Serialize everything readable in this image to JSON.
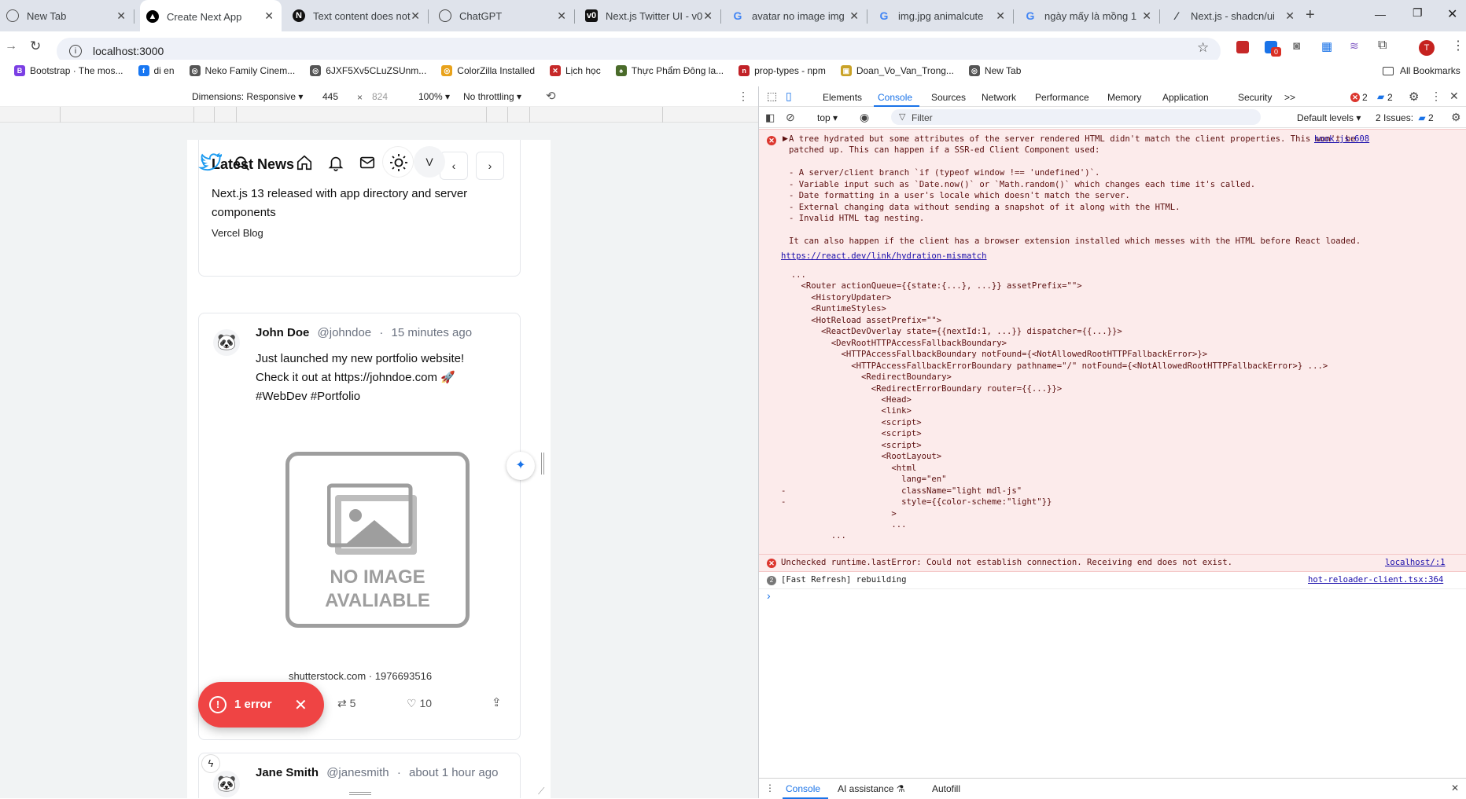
{
  "browser": {
    "tabs": [
      {
        "title": "New Tab"
      },
      {
        "title": "Create Next App"
      },
      {
        "title": "Text content does not"
      },
      {
        "title": "ChatGPT"
      },
      {
        "title": "Next.js Twitter UI - v0"
      },
      {
        "title": "avatar no image img"
      },
      {
        "title": "img.jpg animalcute"
      },
      {
        "title": "ngày mấy là mồng 1"
      },
      {
        "title": "Next.js - shadcn/ui"
      }
    ],
    "new_tab_glyph": "+",
    "url": "localhost:3000",
    "profile_initial": "T",
    "extension_badge": "0",
    "bookmarks": [
      {
        "label": "Bootstrap · The mos...",
        "icon": "B",
        "color": "#7b3fe4"
      },
      {
        "label": "di en",
        "icon": "f",
        "color": "#1877f2"
      },
      {
        "label": "Neko Family Cinem...",
        "icon": "◎",
        "color": "#555"
      },
      {
        "label": "6JXF5Xv5CLuZSUnm...",
        "icon": "◎",
        "color": "#555"
      },
      {
        "label": "ColorZilla Installed",
        "icon": "◎",
        "color": "#e8a21b"
      },
      {
        "label": "Lịch học",
        "icon": "✕",
        "color": "#c62828"
      },
      {
        "label": "Thực Phẩm Đông la...",
        "icon": "♠",
        "color": "#4a6b2a"
      },
      {
        "label": "prop-types - npm",
        "icon": "n",
        "color": "#c12127"
      },
      {
        "label": "Doan_Vo_Van_Trong...",
        "icon": "▣",
        "color": "#c9a227"
      },
      {
        "label": "New Tab",
        "icon": "◎",
        "color": "#555"
      }
    ],
    "all_bookmarks": "All Bookmarks"
  },
  "device_toolbar": {
    "dimensions": "Dimensions: Responsive",
    "width": "445",
    "times": "×",
    "height": "824",
    "zoom": "100%",
    "throttling": "No throttling"
  },
  "page": {
    "latest_news_title": "Latest News",
    "news_item_title": "Next.js 13 released with app directory and server components",
    "news_item_source": "Vercel Blog",
    "avatar_initial": "V",
    "tweets": [
      {
        "name": "John Doe",
        "handle": "@johndoe",
        "sep": "·",
        "time": "15 minutes ago",
        "text_line1": "Just launched my new portfolio website!",
        "text_line2": "Check it out at https://johndoe.com 🚀",
        "text_line3": "#WebDev #Portfolio",
        "image_text1": "NO IMAGE",
        "image_text2": "AVALIABLE",
        "image_caption": "shutterstock.com · 1976693516",
        "retweets": "5",
        "likes": "10"
      },
      {
        "name": "Jane Smith",
        "handle": "@janesmith",
        "sep": "·",
        "time": "about 1 hour ago"
      }
    ],
    "error_toast": {
      "label": "1 error"
    }
  },
  "devtools": {
    "tabs": [
      "Elements",
      "Console",
      "Sources",
      "Network",
      "Performance",
      "Memory",
      "Application",
      "Security"
    ],
    "more_tabs_glyph": ">>",
    "error_count": "2",
    "warning_count": "2",
    "context": "top",
    "filter_placeholder": "Filter",
    "levels": "Default levels",
    "issues": "2 Issues:",
    "issues_count": "2",
    "hydration_message": "A tree hydrated but some attributes of the server rendered HTML didn't match the client properties. This won't be\npatched up. This can happen if a SSR-ed Client Component used:\n\n- A server/client branch `if (typeof window !== 'undefined')`.\n- Variable input such as `Date.now()` or `Math.random()` which changes each time it's called.\n- Date formatting in a user's locale which doesn't match the server.\n- External changing data without sending a snapshot of it along with the HTML.\n- Invalid HTML tag nesting.\n\nIt can also happen if the client has a browser extension installed which messes with the HTML before React loaded.",
    "hydration_link": "https://react.dev/link/hydration-mismatch",
    "hydration_tree": "  ...\n    <Router actionQueue={{state:{...}, ...}} assetPrefix=\"\">\n      <HistoryUpdater>\n      <RuntimeStyles>\n      <HotReload assetPrefix=\"\">\n        <ReactDevOverlay state={{nextId:1, ...}} dispatcher={{...}}>\n          <DevRootHTTPAccessFallbackBoundary>\n            <HTTPAccessFallbackBoundary notFound={<NotAllowedRootHTTPFallbackError>}>\n              <HTTPAccessFallbackErrorBoundary pathname=\"/\" notFound={<NotAllowedRootHTTPFallbackError>} ...>\n                <RedirectBoundary>\n                  <RedirectErrorBoundary router={{...}}>\n                    <Head>\n                    <link>\n                    <script>\n                    <script>\n                    <script>\n                    <RootLayout>\n                      <html\n                        lang=\"en\"\n-                       className=\"light mdl-js\"\n-                       style={{color-scheme:\"light\"}}\n                      >\n                      ...\n          ...",
    "hydration_source": "hook.js:608",
    "runtime_error": "Unchecked runtime.lastError: Could not establish connection. Receiving end does not exist.",
    "runtime_source": "localhost/:1",
    "fast_refresh_count": "2",
    "fast_refresh": "[Fast Refresh] rebuilding",
    "fast_refresh_source": "hot-reloader-client.tsx:364",
    "prompt_glyph": "›",
    "drawer_tabs": [
      "Console",
      "AI assistance",
      "Autofill"
    ]
  }
}
